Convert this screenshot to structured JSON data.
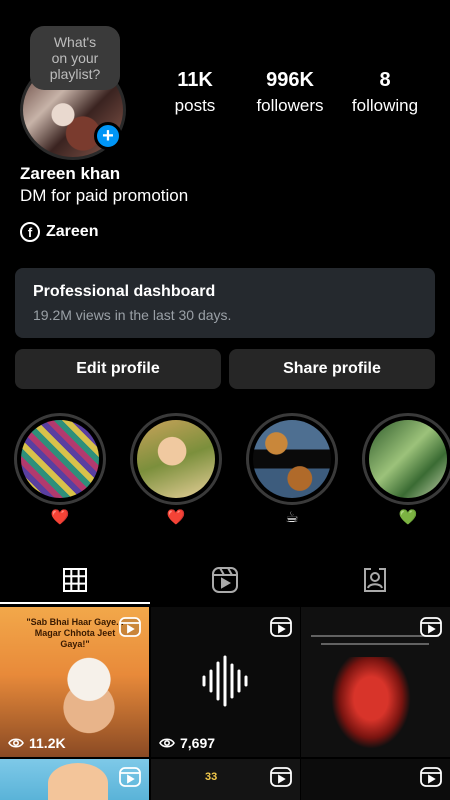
{
  "profile": {
    "note": "What's\non your\nplaylist?",
    "plus": "+",
    "name": "Zareen khan",
    "bio": "DM for paid promotion",
    "facebook_label": "Zareen"
  },
  "stats": [
    {
      "value": "11K",
      "label": "posts"
    },
    {
      "value": "996K",
      "label": "followers"
    },
    {
      "value": "8",
      "label": "following"
    }
  ],
  "dashboard": {
    "title": "Professional dashboard",
    "subtitle": "19.2M views in the last 30 days."
  },
  "buttons": {
    "edit": "Edit profile",
    "share": "Share profile"
  },
  "highlights": [
    {
      "emoji": "❤️"
    },
    {
      "emoji": "❤️"
    },
    {
      "emoji": "☕"
    },
    {
      "emoji": "💚"
    }
  ],
  "tabs": [
    {
      "icon": "grid-icon",
      "active": true
    },
    {
      "icon": "reels-icon",
      "active": false
    },
    {
      "icon": "tagged-icon",
      "active": false
    }
  ],
  "posts": [
    {
      "views": "11.2K",
      "caption_top": "\"Sab Bhai Haar Gaye...",
      "caption_bottom": "Magar Chhota Jeet Gaya!\""
    },
    {
      "views": "7,697"
    },
    {
      "views": ""
    },
    {
      "views": ""
    },
    {
      "views": "",
      "caption_top": "33"
    },
    {
      "views": ""
    }
  ],
  "colors": {
    "accent": "#0095f6",
    "heart": "#e0245e",
    "green_heart": "#6cc04a"
  }
}
